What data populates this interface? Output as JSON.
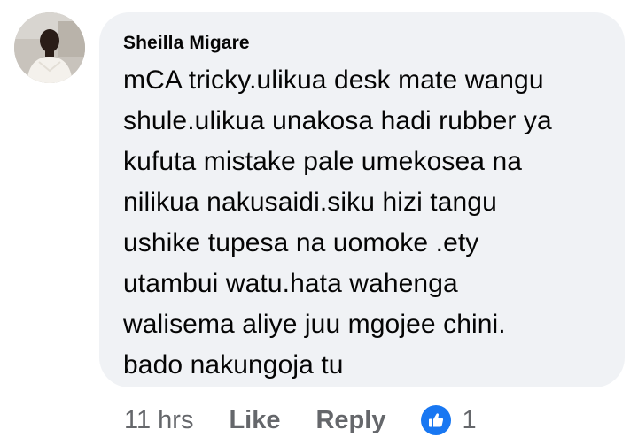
{
  "comment": {
    "author": "Sheilla Migare",
    "text": "mCA tricky.ulikua desk mate wangu\nshule.ulikua unakosa hadi rubber ya\nkufuta mistake pale umekosea na\nnilikua nakusaidi.siku hizi tangu\nushike tupesa na uomoke .ety\nutambui watu.hata wahenga\nwalisema aliye juu mgojee chini.\nbado nakungoja tu",
    "timestamp": "11 hrs",
    "like_label": "Like",
    "reply_label": "Reply",
    "reaction_icon": "like-thumbs-up-icon",
    "reaction_count": "1"
  },
  "colors": {
    "bubble_bg": "#f0f2f5",
    "text": "#050505",
    "meta": "#65676b",
    "like_blue": "#1877f2"
  }
}
